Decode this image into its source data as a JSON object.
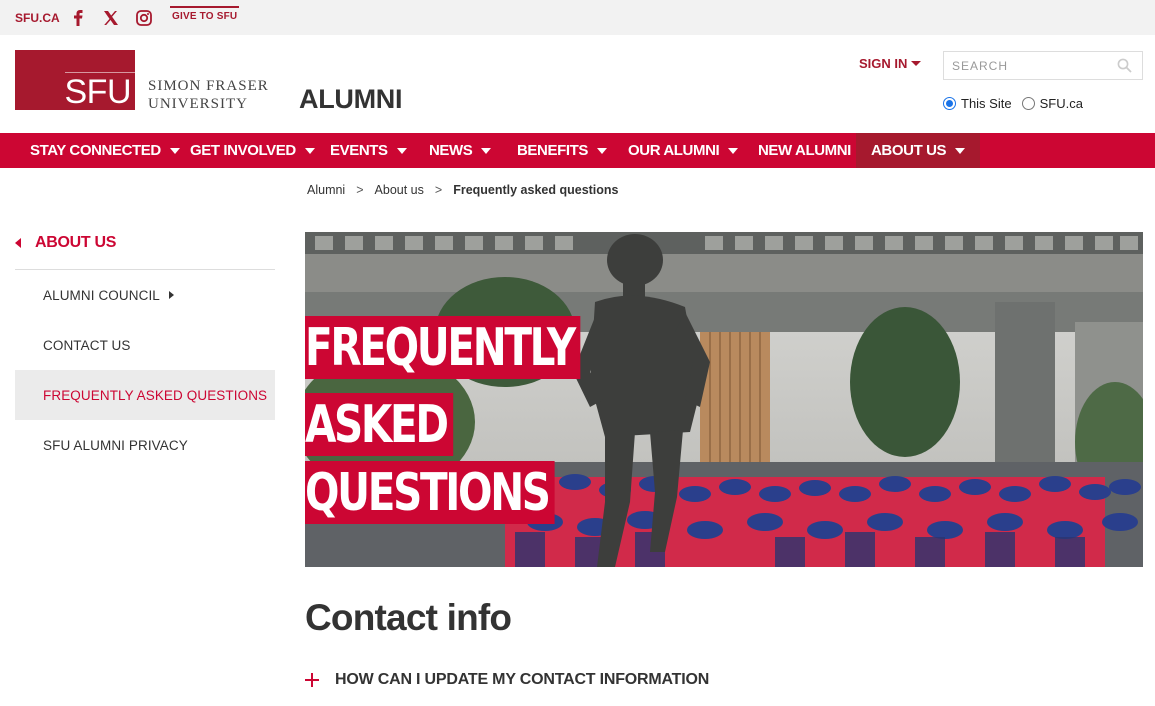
{
  "utility": {
    "home_link": "SFU.CA",
    "give_link": "GIVE TO SFU",
    "social_icons": [
      "facebook-icon",
      "x-icon",
      "instagram-icon"
    ]
  },
  "header": {
    "logo_text": "SFU",
    "university_line1": "SIMON FRASER",
    "university_line2": "UNIVERSITY",
    "site_title": "ALUMNI",
    "sign_in": "SIGN IN",
    "search_placeholder": "SEARCH",
    "scope_options": [
      {
        "label": "This Site",
        "selected": true
      },
      {
        "label": "SFU.ca",
        "selected": false
      }
    ]
  },
  "nav": {
    "items": [
      {
        "label": "STAY CONNECTED",
        "dropdown": true
      },
      {
        "label": "GET INVOLVED",
        "dropdown": true
      },
      {
        "label": "EVENTS",
        "dropdown": true
      },
      {
        "label": "NEWS",
        "dropdown": true
      },
      {
        "label": "BENEFITS",
        "dropdown": true
      },
      {
        "label": "OUR ALUMNI",
        "dropdown": true
      },
      {
        "label": "NEW ALUMNI",
        "dropdown": false
      },
      {
        "label": "ABOUT US",
        "dropdown": true,
        "active": true
      }
    ]
  },
  "breadcrumb": {
    "items": [
      "Alumni",
      "About us"
    ],
    "current": "Frequently asked questions",
    "separator": ">"
  },
  "sidebar": {
    "heading": "ABOUT US",
    "items": [
      {
        "label": "ALUMNI COUNCIL",
        "has_children": true
      },
      {
        "label": "CONTACT US"
      },
      {
        "label": "FREQUENTLY ASKED QUESTIONS",
        "active": true
      },
      {
        "label": "SFU ALUMNI PRIVACY"
      }
    ]
  },
  "hero": {
    "lines": [
      "FREQUENTLY",
      "ASKED",
      "QUESTIONS"
    ]
  },
  "content": {
    "section_title": "Contact info",
    "faq_items": [
      "HOW CAN I UPDATE MY CONTACT INFORMATION"
    ]
  },
  "colors": {
    "brand_red": "#cc0633",
    "dark_red": "#a6192e",
    "utility_bg": "#f2f2f2"
  }
}
